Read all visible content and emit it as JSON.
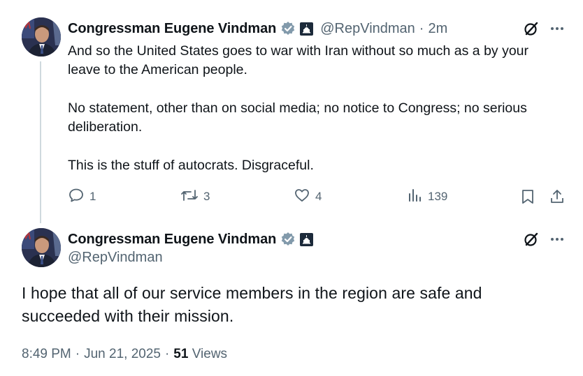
{
  "quoted_post": {
    "author_name": "Congressman Eugene Vindman",
    "handle": "@RepVindman",
    "separator": "·",
    "time": "2m",
    "paragraphs": [
      "And so the United States goes to war with Iran without so much as a by your leave to the American people.",
      "No statement, other than on social media; no notice to Congress; no serious deliberation.",
      "This is the stuff of autocrats. Disgraceful."
    ],
    "replies": "1",
    "reposts": "3",
    "likes": "4",
    "views": "139"
  },
  "main_post": {
    "author_name": "Congressman Eugene Vindman",
    "handle": "@RepVindman",
    "text": "I hope that all of our service members in the region are safe and succeeded with their mission.",
    "time": "8:49 PM",
    "separator": "·",
    "date": "Jun 21, 2025",
    "views_count": "51",
    "views_label": "Views"
  },
  "icons": {
    "verified": "verified-badge-icon",
    "government": "capitol-government-badge-icon",
    "grok": "grok-icon",
    "more": "more-icon",
    "reply": "reply-icon",
    "repost": "repost-icon",
    "like": "like-icon",
    "analytics": "analytics-icon",
    "bookmark": "bookmark-icon",
    "share": "share-icon"
  },
  "colors": {
    "verified_badge": "#829aab",
    "text_primary": "#0f1419",
    "text_secondary": "#536471",
    "thread_line": "#cfd9de"
  }
}
